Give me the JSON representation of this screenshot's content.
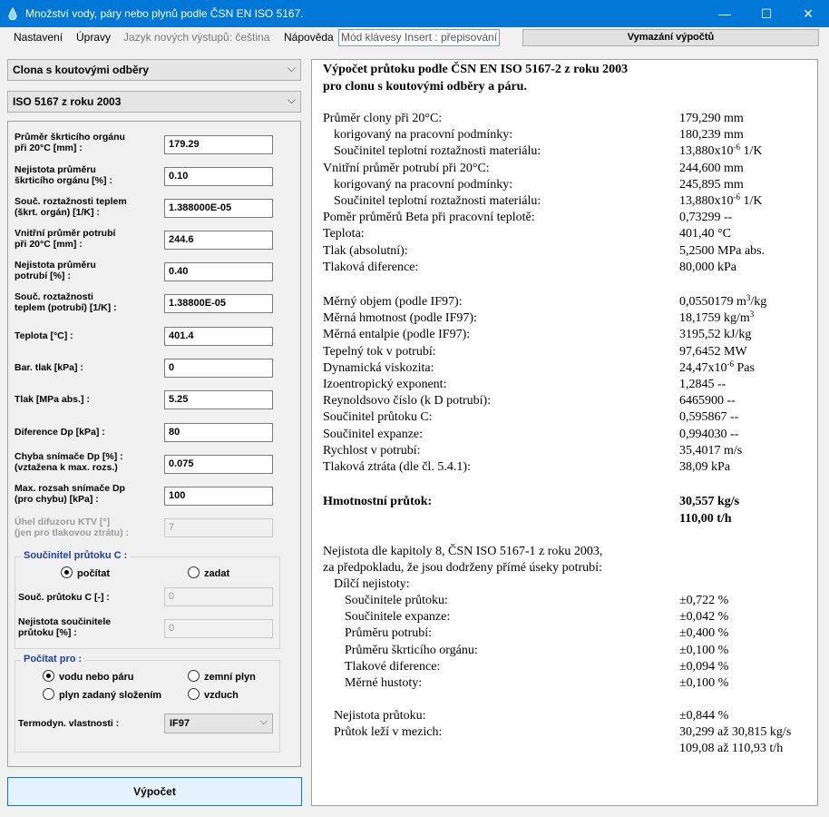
{
  "window": {
    "title": "Množství vody, páry nebo plynů podle ČSN EN ISO 5167.",
    "controls": [
      "—",
      "☐",
      "✕"
    ]
  },
  "menu": {
    "nastaveni": "Nastavení",
    "upravy": "Úpravy",
    "jazyk": "Jazyk nových výstupů: čeština",
    "napoveda": "Nápověda",
    "insert_mode": "Mód klávesy Insert : přepisování",
    "clear_button": "Vymazání výpočtů"
  },
  "selectors": {
    "device": "Clona s koutovými odběry",
    "standard": "ISO 5167 z roku 2003"
  },
  "params": [
    {
      "label1": "Průměr škrticího orgánu",
      "label2": "při 20°C [mm] :",
      "value": "179.29"
    },
    {
      "label1": "Nejistota průměru",
      "label2": "škrticího orgánu [%] :",
      "value": "0.10"
    },
    {
      "label1": "Souč. roztažnosti teplem",
      "label2": "(škrt. orgán) [1/K] :",
      "value": "1.388000E-05"
    },
    {
      "label1": "Vnitřní průměr potrubí",
      "label2": "při 20°C [mm] :",
      "value": "244.6"
    },
    {
      "label1": "Nejistota průměru",
      "label2": "potrubí [%] :",
      "value": "0.40"
    },
    {
      "label1": "Souč. roztažnosti",
      "label2": "teplem (potrubí) [1/K] :",
      "value": "1.38800E-05"
    },
    {
      "label1": "Teplota [°C] :",
      "label2": "",
      "value": "401.4"
    },
    {
      "label1": "Bar. tlak [kPa] :",
      "label2": "",
      "value": "0"
    },
    {
      "label1": "Tlak [MPa abs.] :",
      "label2": "",
      "value": "5.25"
    },
    {
      "label1": "Diference Dp [kPa] :",
      "label2": "",
      "value": "80"
    },
    {
      "label1": "Chyba snímače Dp [%] :",
      "label2": "(vztažena k max. rozs.)",
      "value": "0.075"
    },
    {
      "label1": "Max. rozsah snímače Dp",
      "label2": "(pro chybu) [kPa] :",
      "value": "100"
    },
    {
      "label1": "Úhel difuzoru KTV [°]",
      "label2": "(jen pro tlakovou ztrátu) :",
      "value": "7"
    }
  ],
  "flow_coef": {
    "legend": "Součinitel průtoku C :",
    "opt_compute": "počítat",
    "opt_enter": "zadat",
    "coef_label": "Souč. průtoku C [-] :",
    "coef_value": "0",
    "unc_label1": "Nejistota součinitele",
    "unc_label2": "průtoku [%] :",
    "unc_value": "0"
  },
  "compute_for": {
    "legend": "Počítat pro :",
    "opt_water": "vodu nebo páru",
    "opt_natgas": "zemní plyn",
    "opt_gasmix": "plyn zadaný složením",
    "opt_air": "vzduch",
    "thermo_label": "Termodyn. vlastnosti :",
    "thermo_value": "IF97"
  },
  "calc_button": "Výpočet",
  "report": {
    "heading1": "Výpočet průtoku podle ČSN EN ISO 5167-2 z roku 2003",
    "heading2": "pro clonu s koutovými odběry a páru.",
    "rows_a": [
      {
        "label": "Průměr clony při 20°C:",
        "value": "179,290 mm"
      },
      {
        "label": "korigovaný na pracovní podmínky:",
        "value": "180,239 mm"
      },
      {
        "label": "Součinitel teplotní roztažnosti materiálu:",
        "value": "13,880x10",
        "sup": "-6",
        "unit": " 1/K"
      },
      {
        "label": "Vnitřní průměr potrubí při 20°C:",
        "value": "244,600 mm"
      },
      {
        "label": "korigovaný na pracovní podmínky:",
        "value": "245,895 mm"
      },
      {
        "label": "Součinitel teplotní roztažnosti materiálu:",
        "value": "13,880x10",
        "sup": "-6",
        "unit": " 1/K"
      },
      {
        "label": "Poměr průměrů Beta při pracovní teplotě:",
        "value": "0,73299 --"
      },
      {
        "label": "Teplota:",
        "value": "401,40 °C"
      },
      {
        "label": "Tlak (absolutní):",
        "value": "5,2500 MPa abs."
      },
      {
        "label": "Tlaková diference:",
        "value": "80,000 kPa"
      }
    ],
    "rows_b": [
      {
        "label": "Měrný objem (podle IF97):",
        "value": "0,0550179 m",
        "sup": "3",
        "unit": "/kg"
      },
      {
        "label": "Měrná hmotnost (podle IF97):",
        "value": "18,1759 kg/m",
        "sup": "3",
        "unit": ""
      },
      {
        "label": "Měrná entalpie (podle IF97):",
        "value": "3195,52 kJ/kg"
      },
      {
        "label": "Tepelný tok v potrubí:",
        "value": "97,6452 MW"
      },
      {
        "label": "Dynamická viskozita:",
        "value": "24,47x10",
        "sup": "-6",
        "unit": " Pas"
      },
      {
        "label": "Izoentropický exponent:",
        "value": "1,2845 --"
      },
      {
        "label": "Reynoldsovo číslo (k D potrubí):",
        "value": "6465900 --"
      },
      {
        "label": "Součinitel průtoku C:",
        "value": "0,595867 --"
      },
      {
        "label": "Součinitel expanze:",
        "value": "0,994030 --"
      },
      {
        "label": "Rychlost v potrubí:",
        "value": "35,4017 m/s"
      },
      {
        "label": "Tlaková ztráta (dle čl. 5.4.1):",
        "value": "38,09 kPa"
      }
    ],
    "mass_flow_label": "Hmotnostní průtok:",
    "mass_flow_kgs": "30,557 kg/s",
    "mass_flow_th": "110,00 t/h",
    "unc_intro1": "Nejistota dle kapitoly 8, ČSN ISO 5167-1 z roku 2003,",
    "unc_intro2": "za předpokladu, že jsou dodrženy přímé úseky potrubí:",
    "partial_label": "Dílčí nejistoty:",
    "partials": [
      {
        "label": "Součinitele průtoku:",
        "value": "±0,722 %"
      },
      {
        "label": "Součinitele expanze:",
        "value": "±0,042 %"
      },
      {
        "label": "Průměru potrubí:",
        "value": "±0,400 %"
      },
      {
        "label": "Průměru škrticího orgánu:",
        "value": "±0,100 %"
      },
      {
        "label": "Tlakové diference:",
        "value": "±0,094 %"
      },
      {
        "label": "Měrné hustoty:",
        "value": "±0,100 %"
      }
    ],
    "flow_unc_label": "Nejistota průtoku:",
    "flow_unc_value": "±0,844 %",
    "range_label": "Průtok leží v mezich:",
    "range_kgs": "30,299 až 30,815 kg/s",
    "range_th": "109,08 až 110,93 t/h"
  },
  "colors": {
    "titlebar": "#0078d7",
    "legend_text": "#1f3fa6"
  }
}
